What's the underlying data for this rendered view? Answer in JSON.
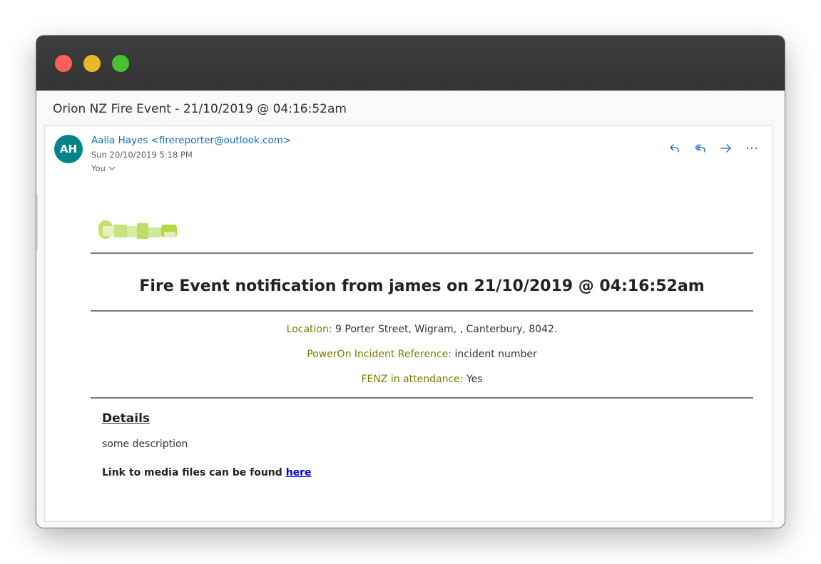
{
  "window": {
    "subject": "Orion NZ Fire Event - 21/10/2019 @ 04:16:52am"
  },
  "message": {
    "avatar_initials": "AH",
    "sender": "Aalia Hayes <firereporter@outlook.com>",
    "date": "Sun 20/10/2019 5:18 PM",
    "recipients": "You",
    "actions": [
      {
        "name": "reply-icon"
      },
      {
        "name": "reply-all-icon"
      },
      {
        "name": "forward-icon"
      },
      {
        "name": "more-actions-icon"
      }
    ]
  },
  "body": {
    "headline": "Fire Event notification from james on 21/10/2019 @ 04:16:52am",
    "location": {
      "label": "Location:",
      "value": "9 Porter Street, Wigram, , Canterbury, 8042."
    },
    "incident": {
      "label": "PowerOn Incident Reference:",
      "value": "incident number"
    },
    "fenz": {
      "label": "FENZ in attendance:",
      "value": "Yes"
    },
    "details_heading": "Details",
    "details_text": "some description",
    "media_text": "Link to media files can be found",
    "media_link": "here"
  },
  "colors": {
    "accent": "#0f6cbd",
    "avatar": "#038387",
    "field_label": "#7a7a00",
    "logo": "#a8d13d"
  }
}
